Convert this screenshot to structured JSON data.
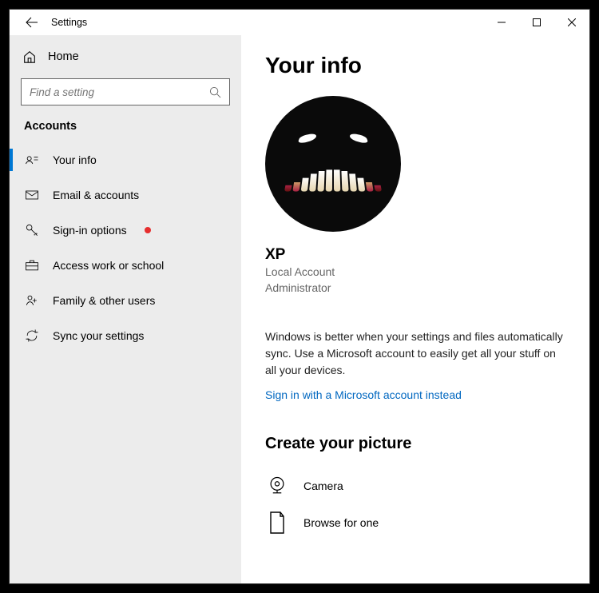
{
  "window": {
    "title": "Settings"
  },
  "sidebar": {
    "home_label": "Home",
    "search_placeholder": "Find a setting",
    "section_header": "Accounts",
    "items": [
      {
        "icon": "user-card-icon",
        "label": "Your info",
        "selected": true
      },
      {
        "icon": "mail-icon",
        "label": "Email & accounts"
      },
      {
        "icon": "key-icon",
        "label": "Sign-in options",
        "alert": true
      },
      {
        "icon": "briefcase-icon",
        "label": "Access work or school"
      },
      {
        "icon": "family-icon",
        "label": "Family & other users"
      },
      {
        "icon": "sync-icon",
        "label": "Sync your settings"
      }
    ]
  },
  "main": {
    "heading": "Your info",
    "username": "XP",
    "account_type": "Local Account",
    "role": "Administrator",
    "sync_text": "Windows is better when your settings and files automatically sync. Use a Microsoft account to easily get all your stuff on all your devices.",
    "ms_link": "Sign in with a Microsoft account instead",
    "picture_heading": "Create your picture",
    "camera_label": "Camera",
    "browse_label": "Browse for one"
  }
}
